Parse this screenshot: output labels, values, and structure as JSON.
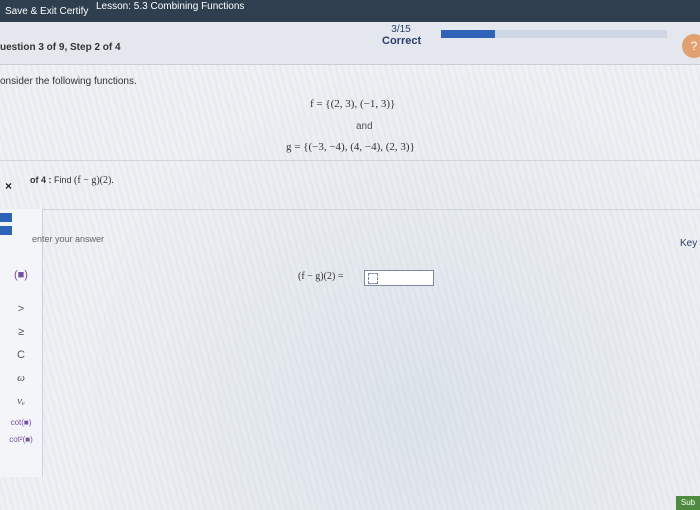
{
  "header": {
    "save_exit": "Save & Exit Certify",
    "lesson": "Lesson: 5.3 Combining Functions"
  },
  "question_bar": {
    "step": "uestion 3 of 9, Step 2 of 4",
    "score_value": "3/15",
    "score_label": "Correct",
    "progress_fraction": 0.24
  },
  "problem": {
    "prompt": "onsider the following functions.",
    "f_def": "f = {(2, 3), (−1, 3)}",
    "and": "and",
    "g_def": "g = {(−3, −4), (4, −4), (2, 3)}"
  },
  "part": {
    "close_glyph": "×",
    "prefix": "of 4 :",
    "instruction": "Find",
    "expression": "(f − g)(2)."
  },
  "answer": {
    "placeholder": "enter your answer",
    "label": "(f − g)(2) ="
  },
  "keypad": {
    "paren": "(■)",
    "gt": ">",
    "ge": "≥",
    "c": "C",
    "omega": "ω",
    "vsub": "vₑ",
    "cot": "cot(■)",
    "cot2": "cot²(■)"
  },
  "sidebar_right": {
    "keys_label": "Key"
  },
  "footer": {
    "submit": "Sub"
  }
}
